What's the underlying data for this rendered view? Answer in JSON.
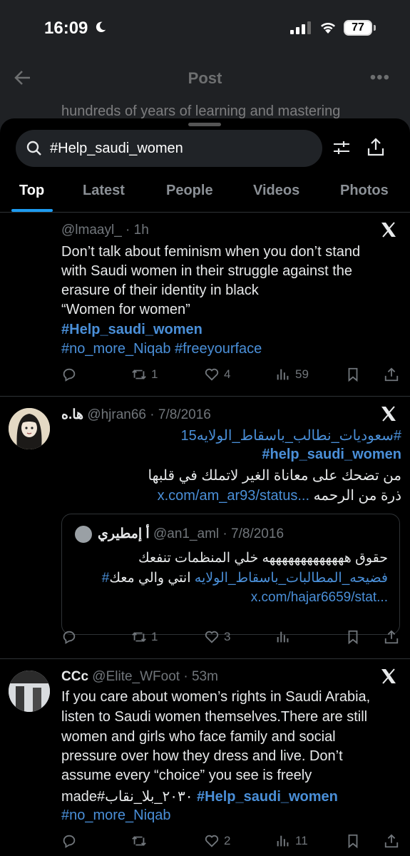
{
  "status_bar": {
    "time": "16:09",
    "battery": "77"
  },
  "background": {
    "title": "Post",
    "peek_text": "hundreds of years of learning and mastering"
  },
  "search": {
    "query": "#Help_saudi_women"
  },
  "tabs": [
    "Top",
    "Latest",
    "People",
    "Videos",
    "Photos"
  ],
  "tweets": [
    {
      "name": "",
      "handle": "@lmaayl_",
      "time": "1h",
      "lines": [
        "Don’t talk about feminism when you don’t stand",
        "with Saudi women in their struggle against the",
        "erasure of their identity in black",
        "“Women for women”"
      ],
      "hashtag_main": "#Help_saudi_women",
      "hashtags": "#no_more_Niqab #freeyourface",
      "replies": "",
      "reposts": "1",
      "likes": "4",
      "views": "59"
    },
    {
      "name": "ها.ه",
      "handle": "@hjran66",
      "time": "7/8/2016",
      "hashtag_line1": "#سعوديات_نطالب_باسقاط_الولايه15",
      "hashtag_line2": "#help_saudi_women",
      "text_line": "من تضحك على معاناة الغير لاتملك في قلبها",
      "text_line2": "ذرة من الرحمه",
      "link": "x.com/am_ar93/status...",
      "quote": {
        "name": "أ إمطيري",
        "handle": "@an1_aml",
        "time": "7/8/2016",
        "line1": "حقوق هههههههههههههه خلي المنظمات تنفعك",
        "line2_text": "انتي والي معك",
        "line2_tag": "#فضيحه_المطالبات_باسقاط_الولايه",
        "link": "x.com/hajar6659/stat..."
      },
      "replies": "",
      "reposts": "1",
      "likes": "3",
      "views": ""
    },
    {
      "name": "CCc",
      "handle": "@Elite_WFoot",
      "time": "53m",
      "lines": [
        "If you care about women’s rights in Saudi Arabia,",
        "listen to Saudi women themselves.There are still",
        "women and girls who face family and social",
        "pressure over how they dress and live. Don’t",
        "assume every “choice” you see is freely"
      ],
      "last_line_start": "made#٢٠٣٠_بلا_نقاب",
      "last_line_tag": "#Help_saudi_women",
      "hashtags": "#no_more_Niqab",
      "replies": "",
      "reposts": "",
      "likes": "2",
      "views": "11"
    }
  ]
}
